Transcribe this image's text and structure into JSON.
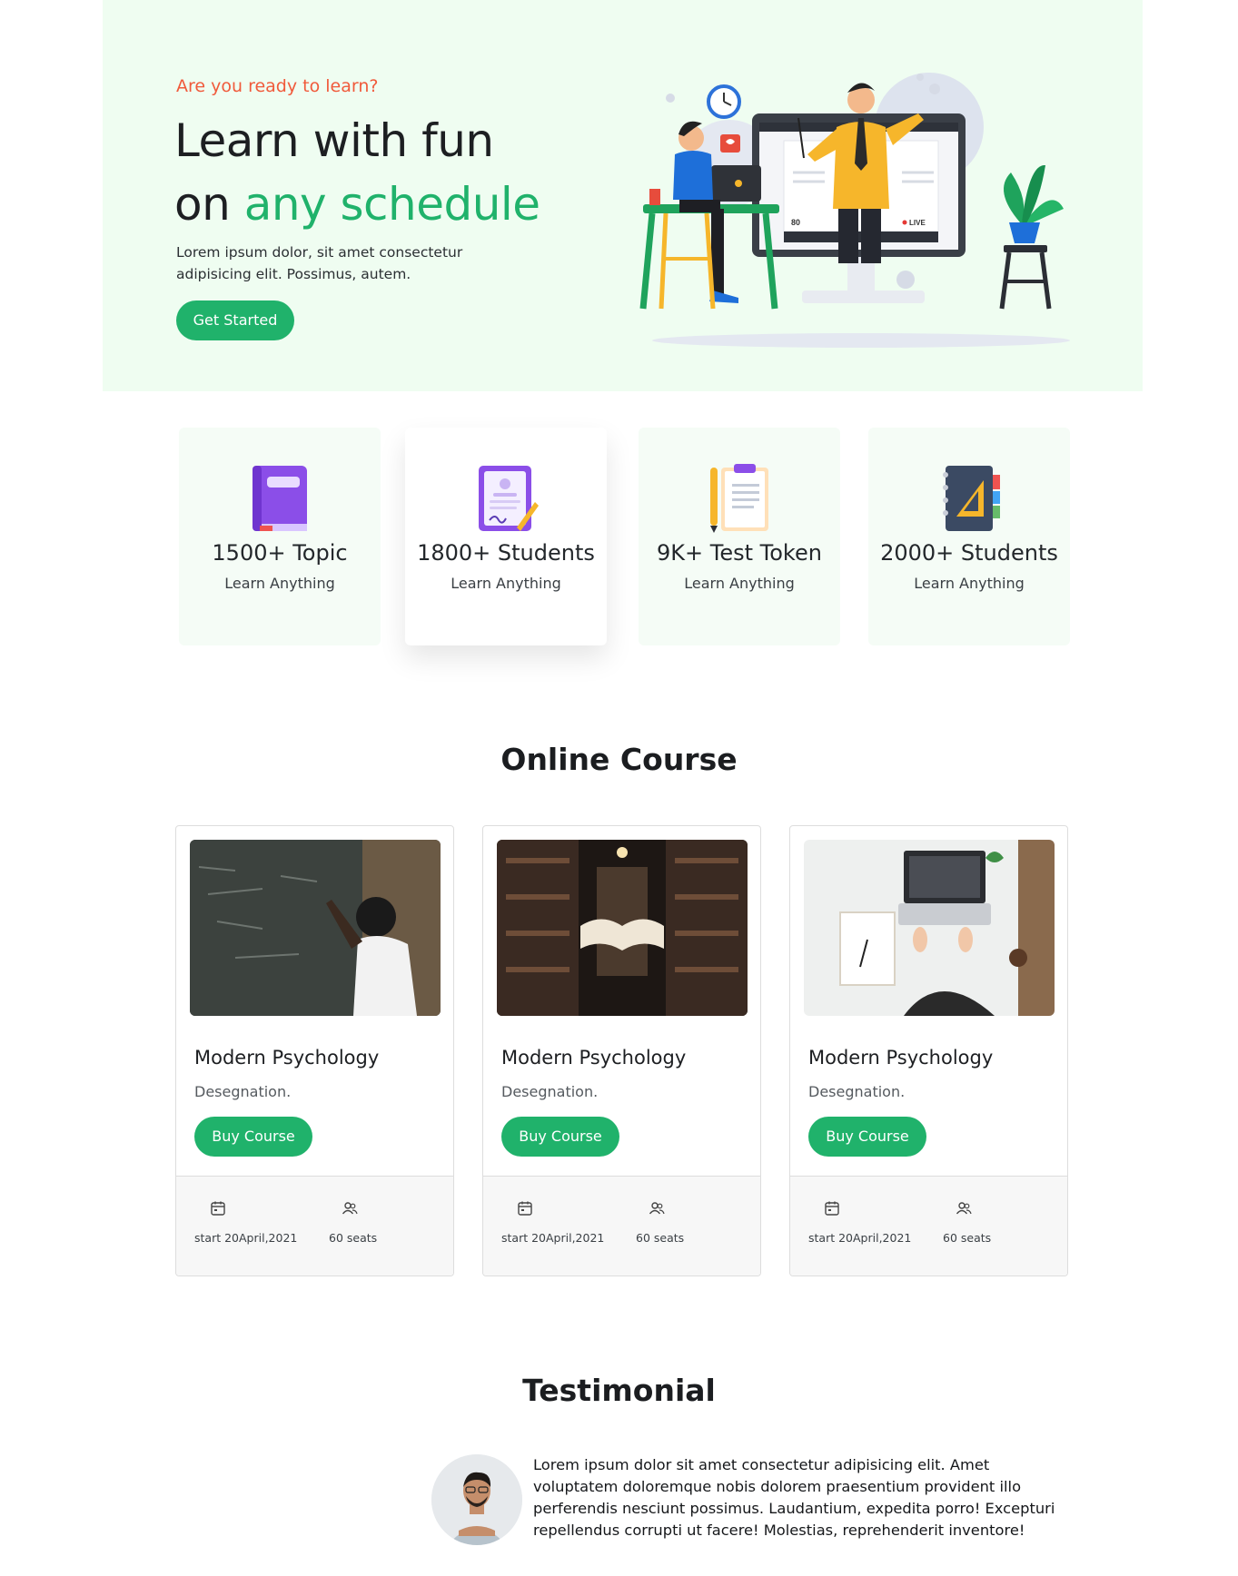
{
  "hero": {
    "kicker": "Are you ready to learn?",
    "title_line1": "Learn with fun",
    "title_line2_prefix": "on ",
    "title_line2_accent": "any schedule",
    "description": "Lorem ipsum dolor, sit amet consectetur adipisicing elit. Possimus, autem.",
    "cta_label": "Get Started",
    "illustration": {
      "viewer_count": "80",
      "live_label": "LIVE"
    }
  },
  "stats": [
    {
      "value": "1500+ Topic",
      "label": "Learn Anything",
      "icon": "book-icon"
    },
    {
      "value": "1800+ Students",
      "label": "Learn Anything",
      "icon": "certificate-icon"
    },
    {
      "value": "9K+ Test Token",
      "label": "Learn Anything",
      "icon": "clipboard-icon"
    },
    {
      "value": "2000+ Students",
      "label": "Learn Anything",
      "icon": "notebook-icon"
    }
  ],
  "courses_section": {
    "title": "Online Course",
    "courses": [
      {
        "title": "Modern Psychology",
        "subtitle": "Desegnation.",
        "button": "Buy Course",
        "start": "start 20April,2021",
        "seats": "60 seats",
        "image": "girl-at-chalkboard-image"
      },
      {
        "title": "Modern Psychology",
        "subtitle": "Desegnation.",
        "button": "Buy Course",
        "start": "start 20April,2021",
        "seats": "60 seats",
        "image": "library-book-image"
      },
      {
        "title": "Modern Psychology",
        "subtitle": "Desegnation.",
        "button": "Buy Course",
        "start": "start 20April,2021",
        "seats": "60 seats",
        "image": "laptop-desk-image"
      }
    ]
  },
  "testimonial_section": {
    "title": "Testimonial",
    "text": "Lorem ipsum dolor sit amet consectetur adipisicing elit. Amet voluptatem doloremque nobis dolorem praesentium provident illo perferendis nesciunt possimus. Laudantium, expedita porro! Excepturi repellendus corrupti ut facere! Molestias, reprehenderit inventore!"
  },
  "colors": {
    "accent": "#20b26b",
    "kicker": "#f05a3b",
    "hero_bg": "#effdf1",
    "stat_bg": "#f5fcf6"
  }
}
